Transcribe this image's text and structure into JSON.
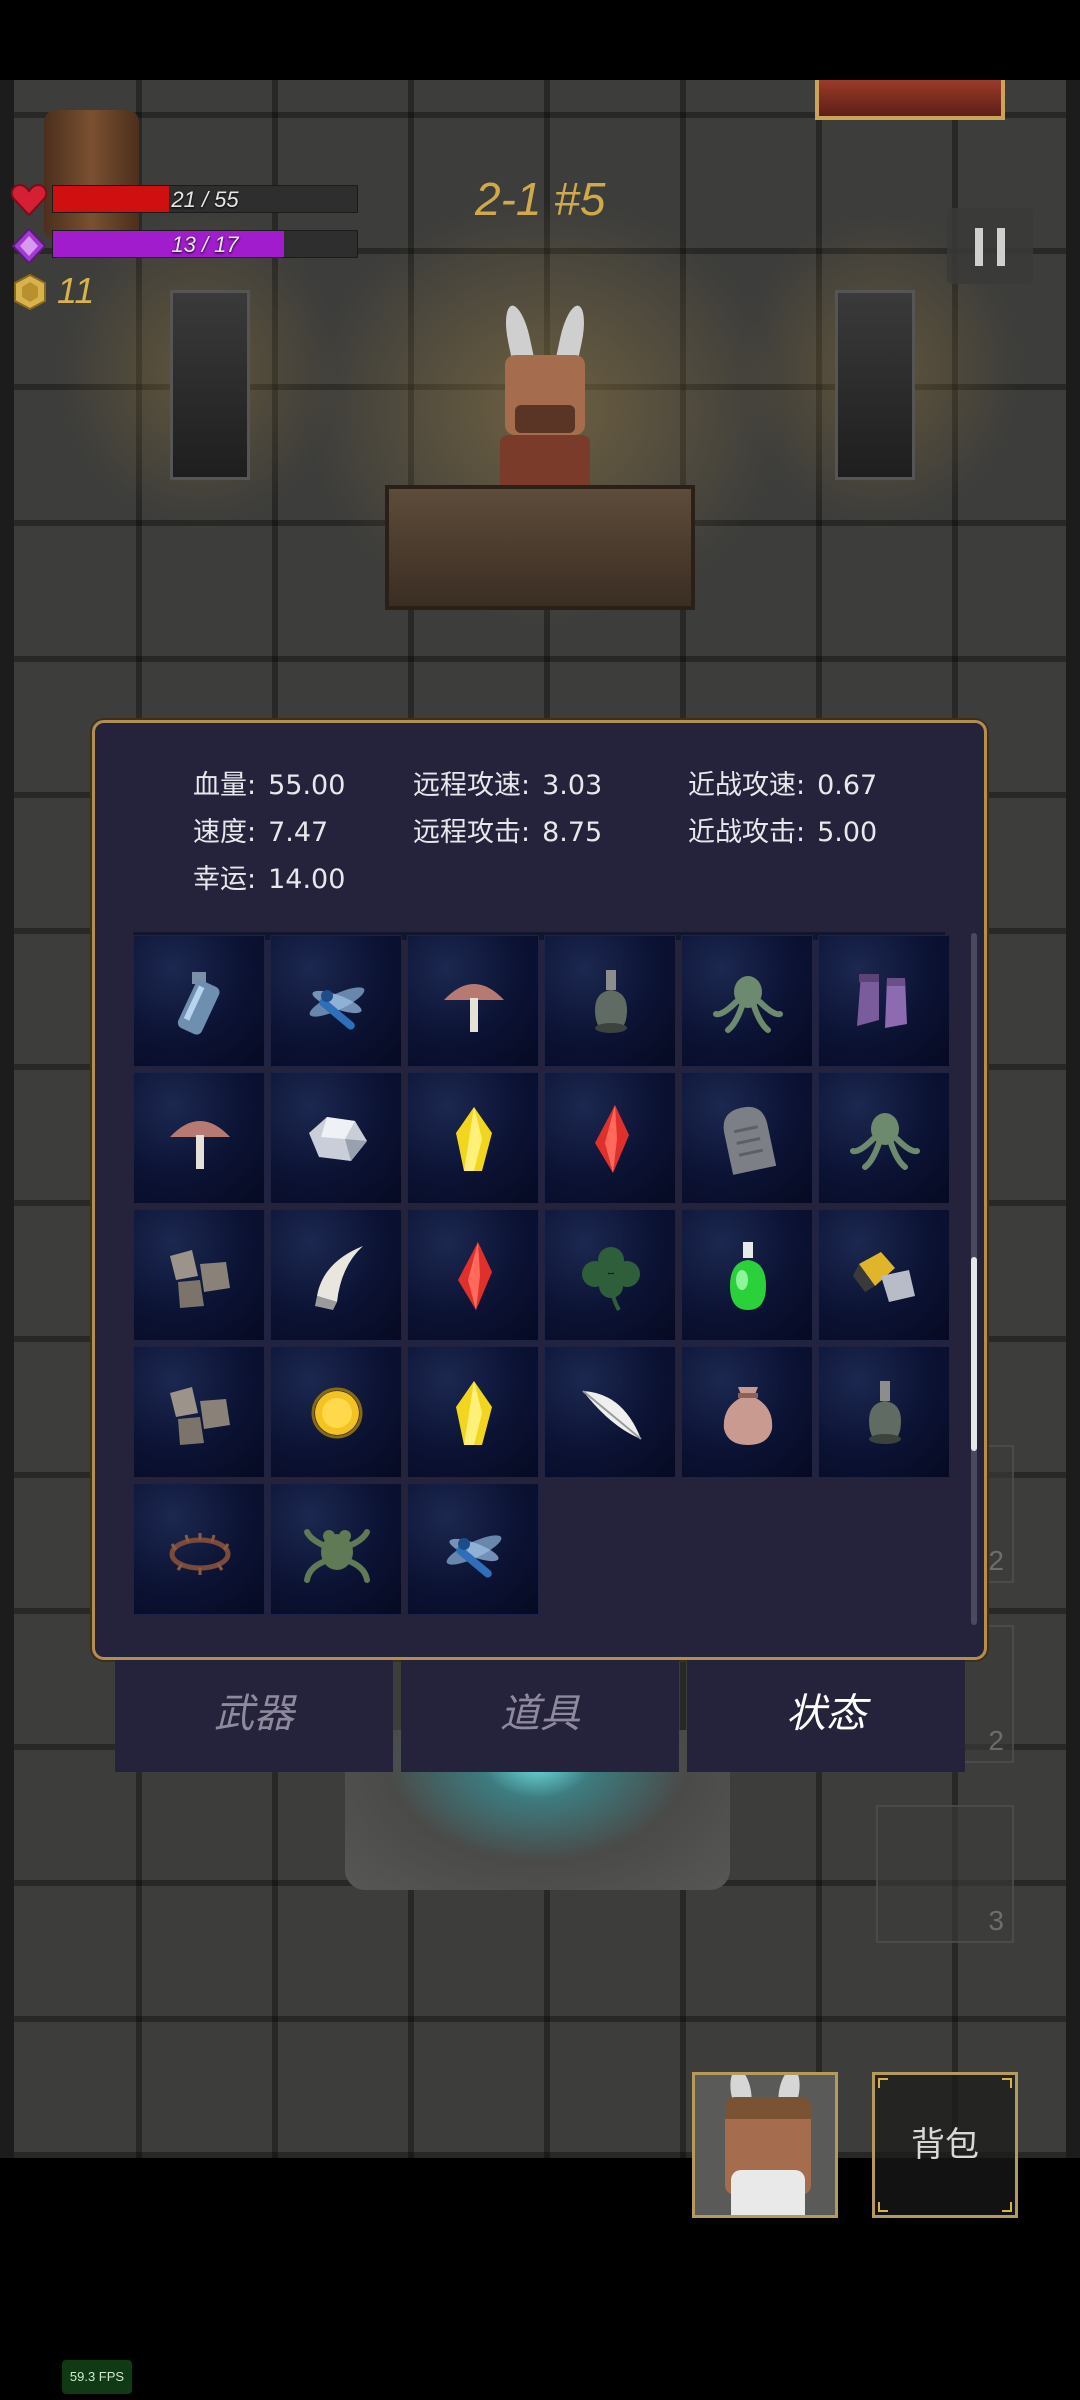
{
  "hud": {
    "hp_text": "21 / 55",
    "hp_fraction": 0.38,
    "mp_text": "13 / 17",
    "mp_fraction": 0.76,
    "coins": "11",
    "level": "2-1 #5",
    "colors": {
      "hp": "#d00f10",
      "mp": "#a01ccc",
      "coin": "#d8b24a",
      "level": "#d0a94d"
    }
  },
  "stats": {
    "hp": {
      "label": "血量:",
      "value": "55.00"
    },
    "ranged_speed": {
      "label": "远程攻速:",
      "value": "3.03"
    },
    "melee_speed": {
      "label": "近战攻速:",
      "value": "0.67"
    },
    "speed": {
      "label": "速度:",
      "value": "7.47"
    },
    "ranged_attack": {
      "label": "远程攻击:",
      "value": "8.75"
    },
    "melee_attack": {
      "label": "近战攻击:",
      "value": "5.00"
    },
    "luck": {
      "label": "幸运:",
      "value": "14.00"
    }
  },
  "inventory": {
    "items": [
      "bottle-icon",
      "dragonfly-icon",
      "mushroom-icon",
      "potion-flask-icon",
      "octopus-icon",
      "boots-icon",
      "mushroom-icon",
      "silver-ore-icon",
      "yellow-gem-icon",
      "red-gem-icon",
      "tombstone-icon",
      "octopus-icon",
      "rocks-icon",
      "horn-icon",
      "red-gem-icon",
      "clover-icon",
      "green-potion-icon",
      "gold-ore-icon",
      "rocks-icon",
      "gold-coin-icon",
      "yellow-gem-icon",
      "feather-icon",
      "pouch-icon",
      "potion-flask-icon",
      "thorn-crown-icon",
      "frog-icon",
      "dragonfly-icon"
    ],
    "scroll_position": 0.65,
    "scroll_visible_fraction": 0.28
  },
  "tabs": [
    {
      "label": "武器",
      "active": false
    },
    {
      "label": "道具",
      "active": false
    },
    {
      "label": "状态",
      "active": true
    }
  ],
  "background_slots": [
    {
      "count": "2"
    },
    {
      "count": "2"
    },
    {
      "count": "3"
    }
  ],
  "bag_label": "背包",
  "fps": "59.3 FPS"
}
